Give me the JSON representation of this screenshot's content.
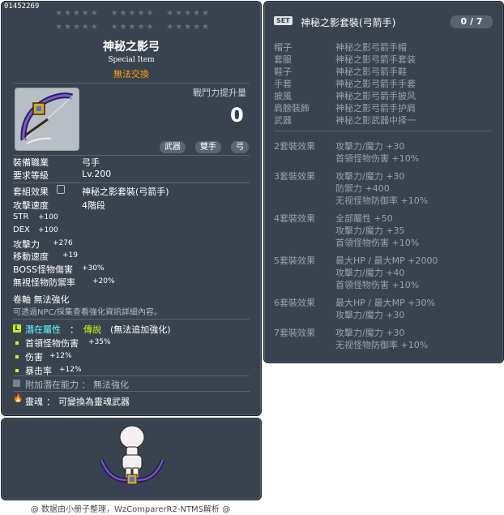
{
  "item": {
    "id": "01452269",
    "title": "神秘之影弓",
    "subtitle": "Special Item",
    "trade_status": "無法交換",
    "power_label": "戰鬥力提升量",
    "power_value": "0",
    "tags": [
      "武器",
      "雙手",
      "弓"
    ],
    "req_job_label": "裝備職業",
    "req_job_value": "弓手",
    "req_level_label": "要求等級",
    "req_level_value": "Lv.200",
    "set_effect_label": "套組效果",
    "set_effect_value": "神秘之影套裝(弓箭手)",
    "attack_speed_label": "攻擊速度",
    "attack_speed_value": "4階段",
    "stats": [
      {
        "label": "STR",
        "value": "+100"
      },
      {
        "label": "DEX",
        "value": "+100"
      },
      {
        "label": "攻擊力",
        "value": "+276"
      },
      {
        "label": "移動速度",
        "value": "+19"
      },
      {
        "label": "BOSS怪物傷害",
        "value": "+30%"
      },
      {
        "label": "無視怪物防禦率",
        "value": "+20%"
      }
    ],
    "scroll_text": "卷軸  無法強化",
    "scroll_note": "可透過NPC/採集查看強化資訊詳細內容。",
    "potential_label": "潛在屬性",
    "potential_grade": "傳說",
    "potential_note": "(無法追加強化)",
    "potentials": [
      {
        "label": "首領怪物伤害",
        "value": "+35%"
      },
      {
        "label": "伤害",
        "value": "+12%"
      },
      {
        "label": "暴击率",
        "value": "+12%"
      }
    ],
    "additional_potential": "附加潛在能力 ： 無法強化",
    "soul_label": "靈魂",
    "soul_value": "可變換為靈魂武器"
  },
  "set": {
    "badge": "SET",
    "title": "神秘之影套裝(弓箭手)",
    "count": "0 / 7",
    "pieces": [
      {
        "slot": "帽子",
        "name": "神秘之影弓箭手帽"
      },
      {
        "slot": "套服",
        "name": "神秘之影弓箭手套装"
      },
      {
        "slot": "鞋子",
        "name": "神秘之影弓箭手鞋"
      },
      {
        "slot": "手套",
        "name": "神秘之影弓箭手手套"
      },
      {
        "slot": "披風",
        "name": "神秘之影弓箭手披风"
      },
      {
        "slot": "肩膀裝飾",
        "name": "神秘之影弓箭手护肩"
      },
      {
        "slot": "武器",
        "name": "神秘之影武器中择一"
      }
    ],
    "effects": [
      {
        "title": "2套裝效果",
        "lines": [
          "攻擊力/魔力 +30",
          "首領怪物伤害 +10%"
        ]
      },
      {
        "title": "3套裝效果",
        "lines": [
          "攻擊力/魔力 +30",
          "防禦力 +400",
          "无视怪物防御率 +10%"
        ]
      },
      {
        "title": "4套裝效果",
        "lines": [
          "全部屬性 +50",
          "攻擊力/魔力 +35",
          "首領怪物伤害 +10%"
        ]
      },
      {
        "title": "5套裝效果",
        "lines": [
          "最大HP / 最大MP +2000",
          "攻擊力/魔力 +40",
          "首領怪物伤害 +10%"
        ]
      },
      {
        "title": "6套裝效果",
        "lines": [
          "最大HP / 最大MP +30%",
          "攻擊力/魔力 +30"
        ]
      },
      {
        "title": "7套裝效果",
        "lines": [
          "攻擊力/魔力 +30",
          "无视怪物防御率 +10%"
        ]
      }
    ]
  },
  "footer": "@ 数据由小册子整理，WzComparerR2-NTMS解析 @",
  "colors": {
    "panel_bg": "#394350",
    "trade_status": "#ffa200",
    "potential_grade": "#ccff00",
    "potential_label": "#66ffff"
  }
}
